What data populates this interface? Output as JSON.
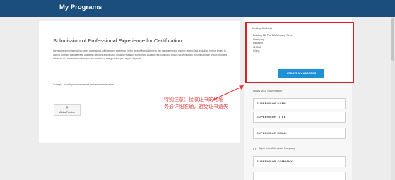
{
  "header": {
    "title": "My Programs"
  },
  "card": {
    "title": "Submission of Professional Experience for Certification",
    "body": "We require a minimum of two years professional full-time work experience in the area of financial/energy risk management or another related field, including, but not limited to, trading, portfolio management, academic (tenure track faculty), industry research, economics, auditing, risk consulting and or risk technology. Your description should include a minimum of 4 sentences on how you use financial or energy risk in your day-to-day work.",
    "instruction": "To begin, submit your most recent work experience below.",
    "add_button": {
      "icon": "plus-icon",
      "label": "Add a Position"
    }
  },
  "annotation": {
    "line1": "特别注意：接收证书的地址",
    "line2": "务必详细准确，避免证书遗失"
  },
  "mailing": {
    "title": "Mailing Address",
    "lines": [
      "Building 18, The 2th Minjiang Street",
      "Shenyang",
      "Liaoning",
      "110045",
      "China"
    ],
    "update_button": "UPDATE MY ADDRESS"
  },
  "supervisor": {
    "notify_label": "Notify your Supervisor?",
    "fields": [
      "SUPERVISOR NAME",
      "SUPERVISOR TITLE",
      "SUPERVISOR EMAIL"
    ],
    "checkbox_label": "Supervisor Address is Company",
    "company_field": "SUPERVISOR COMPANY"
  },
  "colors": {
    "header": "#1b4e7c",
    "accent": "#1e90d6",
    "highlight": "#e02020"
  }
}
